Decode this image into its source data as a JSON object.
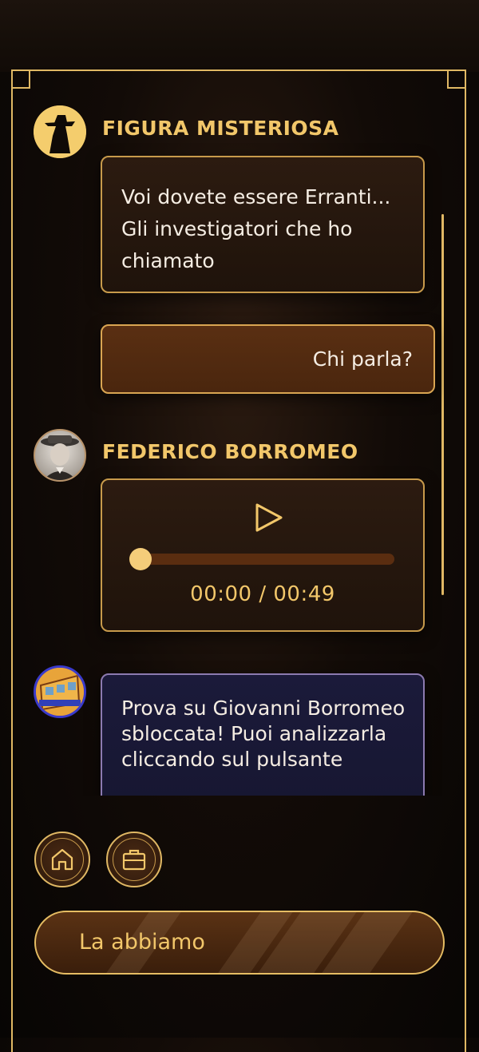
{
  "chat": {
    "messages": [
      {
        "sender": "FIGURA MISTERIOSA",
        "avatar_icon": "mysterious-figure-silhouette",
        "text": "Voi dovete essere Erranti... Gli investigatori che ho chiamato"
      },
      {
        "sender": "player",
        "text": "Chi parla?"
      },
      {
        "sender": "FEDERICO BORROMEO",
        "avatar_icon": "federico-borromeo-portrait",
        "type": "audio",
        "audio_time": "00:00 / 00:49",
        "progress": 0
      },
      {
        "sender": "system",
        "avatar_icon": "tram-icon",
        "text": "Prova su Giovanni Borromeo sbloccata! Puoi analizzarla cliccando sul pulsante"
      }
    ]
  },
  "nav": {
    "home_icon": "home-icon",
    "briefcase_icon": "briefcase-icon"
  },
  "cta": {
    "label": "La abbiamo"
  },
  "colors": {
    "gold": "#e0b864",
    "gold_text": "#f2c76a",
    "bubble_dark": "#2c1b10",
    "bubble_player": "#5a2f12",
    "bubble_system": "#1b1a3a"
  }
}
